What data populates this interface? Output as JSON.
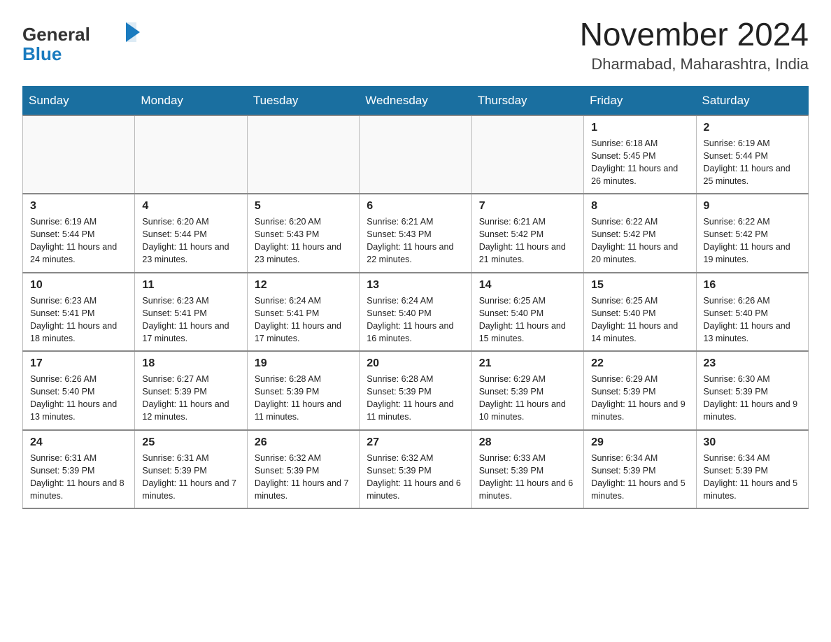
{
  "logo": {
    "general": "General",
    "blue": "Blue"
  },
  "header": {
    "title": "November 2024",
    "subtitle": "Dharmabad, Maharashtra, India"
  },
  "weekdays": [
    "Sunday",
    "Monday",
    "Tuesday",
    "Wednesday",
    "Thursday",
    "Friday",
    "Saturday"
  ],
  "weeks": [
    [
      {
        "day": "",
        "info": ""
      },
      {
        "day": "",
        "info": ""
      },
      {
        "day": "",
        "info": ""
      },
      {
        "day": "",
        "info": ""
      },
      {
        "day": "",
        "info": ""
      },
      {
        "day": "1",
        "info": "Sunrise: 6:18 AM\nSunset: 5:45 PM\nDaylight: 11 hours and 26 minutes."
      },
      {
        "day": "2",
        "info": "Sunrise: 6:19 AM\nSunset: 5:44 PM\nDaylight: 11 hours and 25 minutes."
      }
    ],
    [
      {
        "day": "3",
        "info": "Sunrise: 6:19 AM\nSunset: 5:44 PM\nDaylight: 11 hours and 24 minutes."
      },
      {
        "day": "4",
        "info": "Sunrise: 6:20 AM\nSunset: 5:44 PM\nDaylight: 11 hours and 23 minutes."
      },
      {
        "day": "5",
        "info": "Sunrise: 6:20 AM\nSunset: 5:43 PM\nDaylight: 11 hours and 23 minutes."
      },
      {
        "day": "6",
        "info": "Sunrise: 6:21 AM\nSunset: 5:43 PM\nDaylight: 11 hours and 22 minutes."
      },
      {
        "day": "7",
        "info": "Sunrise: 6:21 AM\nSunset: 5:42 PM\nDaylight: 11 hours and 21 minutes."
      },
      {
        "day": "8",
        "info": "Sunrise: 6:22 AM\nSunset: 5:42 PM\nDaylight: 11 hours and 20 minutes."
      },
      {
        "day": "9",
        "info": "Sunrise: 6:22 AM\nSunset: 5:42 PM\nDaylight: 11 hours and 19 minutes."
      }
    ],
    [
      {
        "day": "10",
        "info": "Sunrise: 6:23 AM\nSunset: 5:41 PM\nDaylight: 11 hours and 18 minutes."
      },
      {
        "day": "11",
        "info": "Sunrise: 6:23 AM\nSunset: 5:41 PM\nDaylight: 11 hours and 17 minutes."
      },
      {
        "day": "12",
        "info": "Sunrise: 6:24 AM\nSunset: 5:41 PM\nDaylight: 11 hours and 17 minutes."
      },
      {
        "day": "13",
        "info": "Sunrise: 6:24 AM\nSunset: 5:40 PM\nDaylight: 11 hours and 16 minutes."
      },
      {
        "day": "14",
        "info": "Sunrise: 6:25 AM\nSunset: 5:40 PM\nDaylight: 11 hours and 15 minutes."
      },
      {
        "day": "15",
        "info": "Sunrise: 6:25 AM\nSunset: 5:40 PM\nDaylight: 11 hours and 14 minutes."
      },
      {
        "day": "16",
        "info": "Sunrise: 6:26 AM\nSunset: 5:40 PM\nDaylight: 11 hours and 13 minutes."
      }
    ],
    [
      {
        "day": "17",
        "info": "Sunrise: 6:26 AM\nSunset: 5:40 PM\nDaylight: 11 hours and 13 minutes."
      },
      {
        "day": "18",
        "info": "Sunrise: 6:27 AM\nSunset: 5:39 PM\nDaylight: 11 hours and 12 minutes."
      },
      {
        "day": "19",
        "info": "Sunrise: 6:28 AM\nSunset: 5:39 PM\nDaylight: 11 hours and 11 minutes."
      },
      {
        "day": "20",
        "info": "Sunrise: 6:28 AM\nSunset: 5:39 PM\nDaylight: 11 hours and 11 minutes."
      },
      {
        "day": "21",
        "info": "Sunrise: 6:29 AM\nSunset: 5:39 PM\nDaylight: 11 hours and 10 minutes."
      },
      {
        "day": "22",
        "info": "Sunrise: 6:29 AM\nSunset: 5:39 PM\nDaylight: 11 hours and 9 minutes."
      },
      {
        "day": "23",
        "info": "Sunrise: 6:30 AM\nSunset: 5:39 PM\nDaylight: 11 hours and 9 minutes."
      }
    ],
    [
      {
        "day": "24",
        "info": "Sunrise: 6:31 AM\nSunset: 5:39 PM\nDaylight: 11 hours and 8 minutes."
      },
      {
        "day": "25",
        "info": "Sunrise: 6:31 AM\nSunset: 5:39 PM\nDaylight: 11 hours and 7 minutes."
      },
      {
        "day": "26",
        "info": "Sunrise: 6:32 AM\nSunset: 5:39 PM\nDaylight: 11 hours and 7 minutes."
      },
      {
        "day": "27",
        "info": "Sunrise: 6:32 AM\nSunset: 5:39 PM\nDaylight: 11 hours and 6 minutes."
      },
      {
        "day": "28",
        "info": "Sunrise: 6:33 AM\nSunset: 5:39 PM\nDaylight: 11 hours and 6 minutes."
      },
      {
        "day": "29",
        "info": "Sunrise: 6:34 AM\nSunset: 5:39 PM\nDaylight: 11 hours and 5 minutes."
      },
      {
        "day": "30",
        "info": "Sunrise: 6:34 AM\nSunset: 5:39 PM\nDaylight: 11 hours and 5 minutes."
      }
    ]
  ],
  "colors": {
    "header_bg": "#1a6fa0",
    "header_text": "#ffffff",
    "border": "#bbbbbb"
  }
}
